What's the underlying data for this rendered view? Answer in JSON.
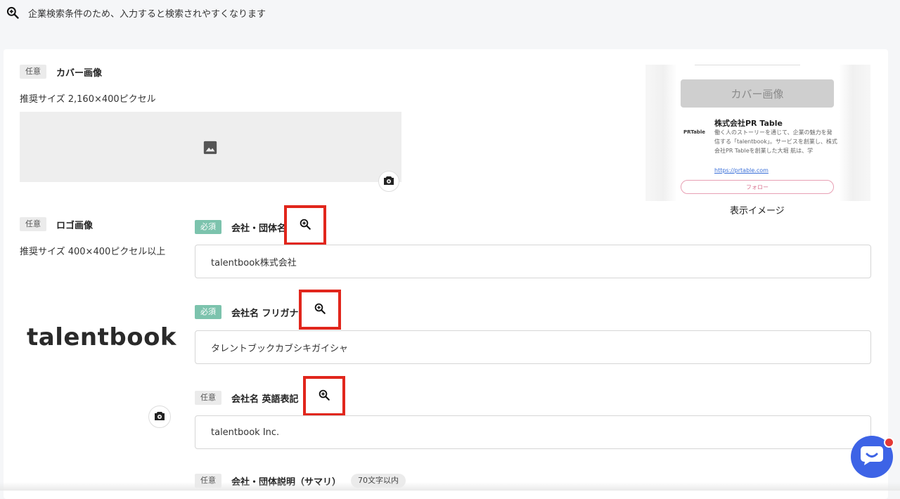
{
  "notice": {
    "text": "企業検索条件のため、入力すると検索されやすくなります",
    "icon": "zoom-in-icon"
  },
  "cover": {
    "badge": "任意",
    "title": "カバー画像",
    "size_hint": "推奨サイズ 2,160×400ピクセル",
    "placeholder_icon": "image-icon",
    "upload_icon": "camera-icon"
  },
  "preview": {
    "cover_label": "カバー画像",
    "company_name": "株式会社PR Table",
    "logo_text": "PRTable",
    "description": "働く人のストーリーを通じて、企業の魅力を発信する「talentbook」。サービスを創業し、株式会社PR Tableを創業した大堀 航は、学",
    "url": "https://prtable.com",
    "follow_label": "フォロー",
    "caption": "表示イメージ"
  },
  "logo": {
    "badge": "任意",
    "title": "ロゴ画像",
    "size_hint": "推奨サイズ 400×400ピクセル以上",
    "brand_text": "talentbook",
    "upload_icon": "camera-icon"
  },
  "fields": [
    {
      "badge": "必須",
      "label": "会社・団体名",
      "value": "talentbook株式会社"
    },
    {
      "badge": "必須",
      "label": "会社名 フリガナ",
      "value": "タレントブックカブシキガイシャ"
    },
    {
      "badge": "任意",
      "label": "会社名 英語表記",
      "value": "talentbook Inc."
    },
    {
      "badge": "任意",
      "label": "会社・団体説明（サマリ）",
      "limit": "70文字以内"
    }
  ],
  "colors": {
    "required_badge": "#7cc3ad",
    "optional_badge": "#ebebeb",
    "highlight": "#e1261c",
    "chat_button": "#3d63e6"
  }
}
